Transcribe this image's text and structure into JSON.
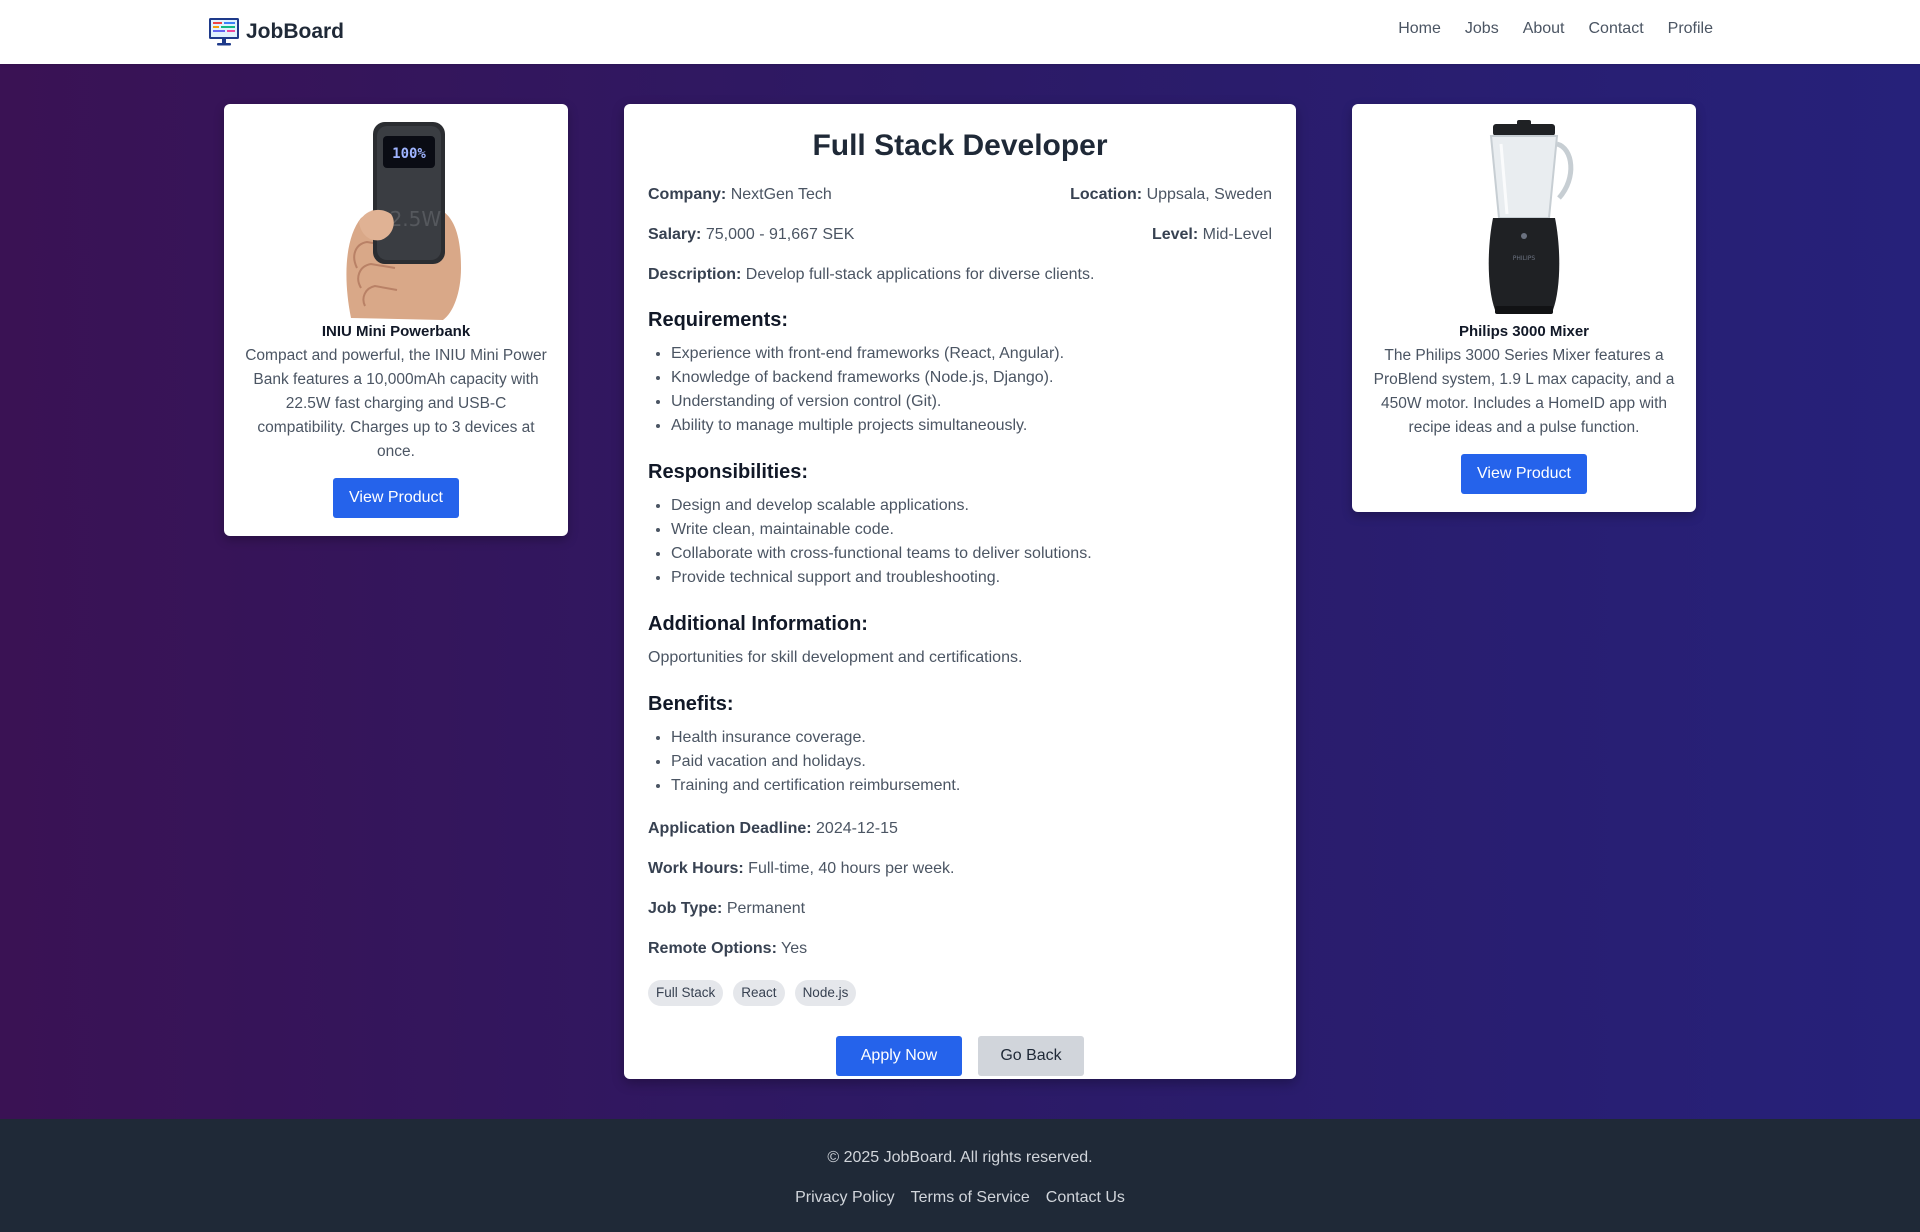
{
  "header": {
    "brand": "JobBoard",
    "nav": [
      "Home",
      "Jobs",
      "About",
      "Contact",
      "Profile"
    ]
  },
  "ads": {
    "left": {
      "name": "INIU Mini Powerbank",
      "description": "Compact and powerful, the INIU Mini Power Bank features a 10,000mAh capacity with 22.5W fast charging and USB-C compatibility. Charges up to 3 devices at once.",
      "button": "View Product",
      "image_icon": "powerbank-in-hand",
      "screen_text": "100%",
      "body_text": "22.5W"
    },
    "right": {
      "name": "Philips 3000 Mixer",
      "description": "The Philips 3000 Series Mixer features a ProBlend system, 1.9 L max capacity, and a 450W motor. Includes a HomeID app with recipe ideas and a pulse function.",
      "button": "View Product",
      "image_icon": "blender",
      "brand_mark": "PHILIPS"
    }
  },
  "job": {
    "title": "Full Stack Developer",
    "company_label": "Company:",
    "company": "NextGen Tech",
    "location_label": "Location:",
    "location": "Uppsala, Sweden",
    "salary_label": "Salary:",
    "salary": "75,000 - 91,667 SEK",
    "level_label": "Level:",
    "level": "Mid-Level",
    "description_label": "Description:",
    "description": "Develop full-stack applications for diverse clients.",
    "requirements_title": "Requirements:",
    "requirements": [
      "Experience with front-end frameworks (React, Angular).",
      "Knowledge of backend frameworks (Node.js, Django).",
      "Understanding of version control (Git).",
      "Ability to manage multiple projects simultaneously."
    ],
    "responsibilities_title": "Responsibilities:",
    "responsibilities": [
      "Design and develop scalable applications.",
      "Write clean, maintainable code.",
      "Collaborate with cross-functional teams to deliver solutions.",
      "Provide technical support and troubleshooting."
    ],
    "additional_title": "Additional Information:",
    "additional": "Opportunities for skill development and certifications.",
    "benefits_title": "Benefits:",
    "benefits": [
      "Health insurance coverage.",
      "Paid vacation and holidays.",
      "Training and certification reimbursement."
    ],
    "deadline_label": "Application Deadline:",
    "deadline": "2024-12-15",
    "hours_label": "Work Hours:",
    "hours": "Full-time, 40 hours per week.",
    "type_label": "Job Type:",
    "type": "Permanent",
    "remote_label": "Remote Options:",
    "remote": "Yes",
    "tags": [
      "Full Stack",
      "React",
      "Node.js"
    ],
    "apply_button": "Apply Now",
    "back_button": "Go Back"
  },
  "footer": {
    "copyright": "© 2025 JobBoard. All rights reserved.",
    "links": [
      "Privacy Policy",
      "Terms of Service",
      "Contact Us"
    ]
  },
  "colors": {
    "primary_button": "#2563eb",
    "background_gradient_start": "#3a1254",
    "background_gradient_end": "#26217a",
    "footer_bg": "#1f2937"
  }
}
